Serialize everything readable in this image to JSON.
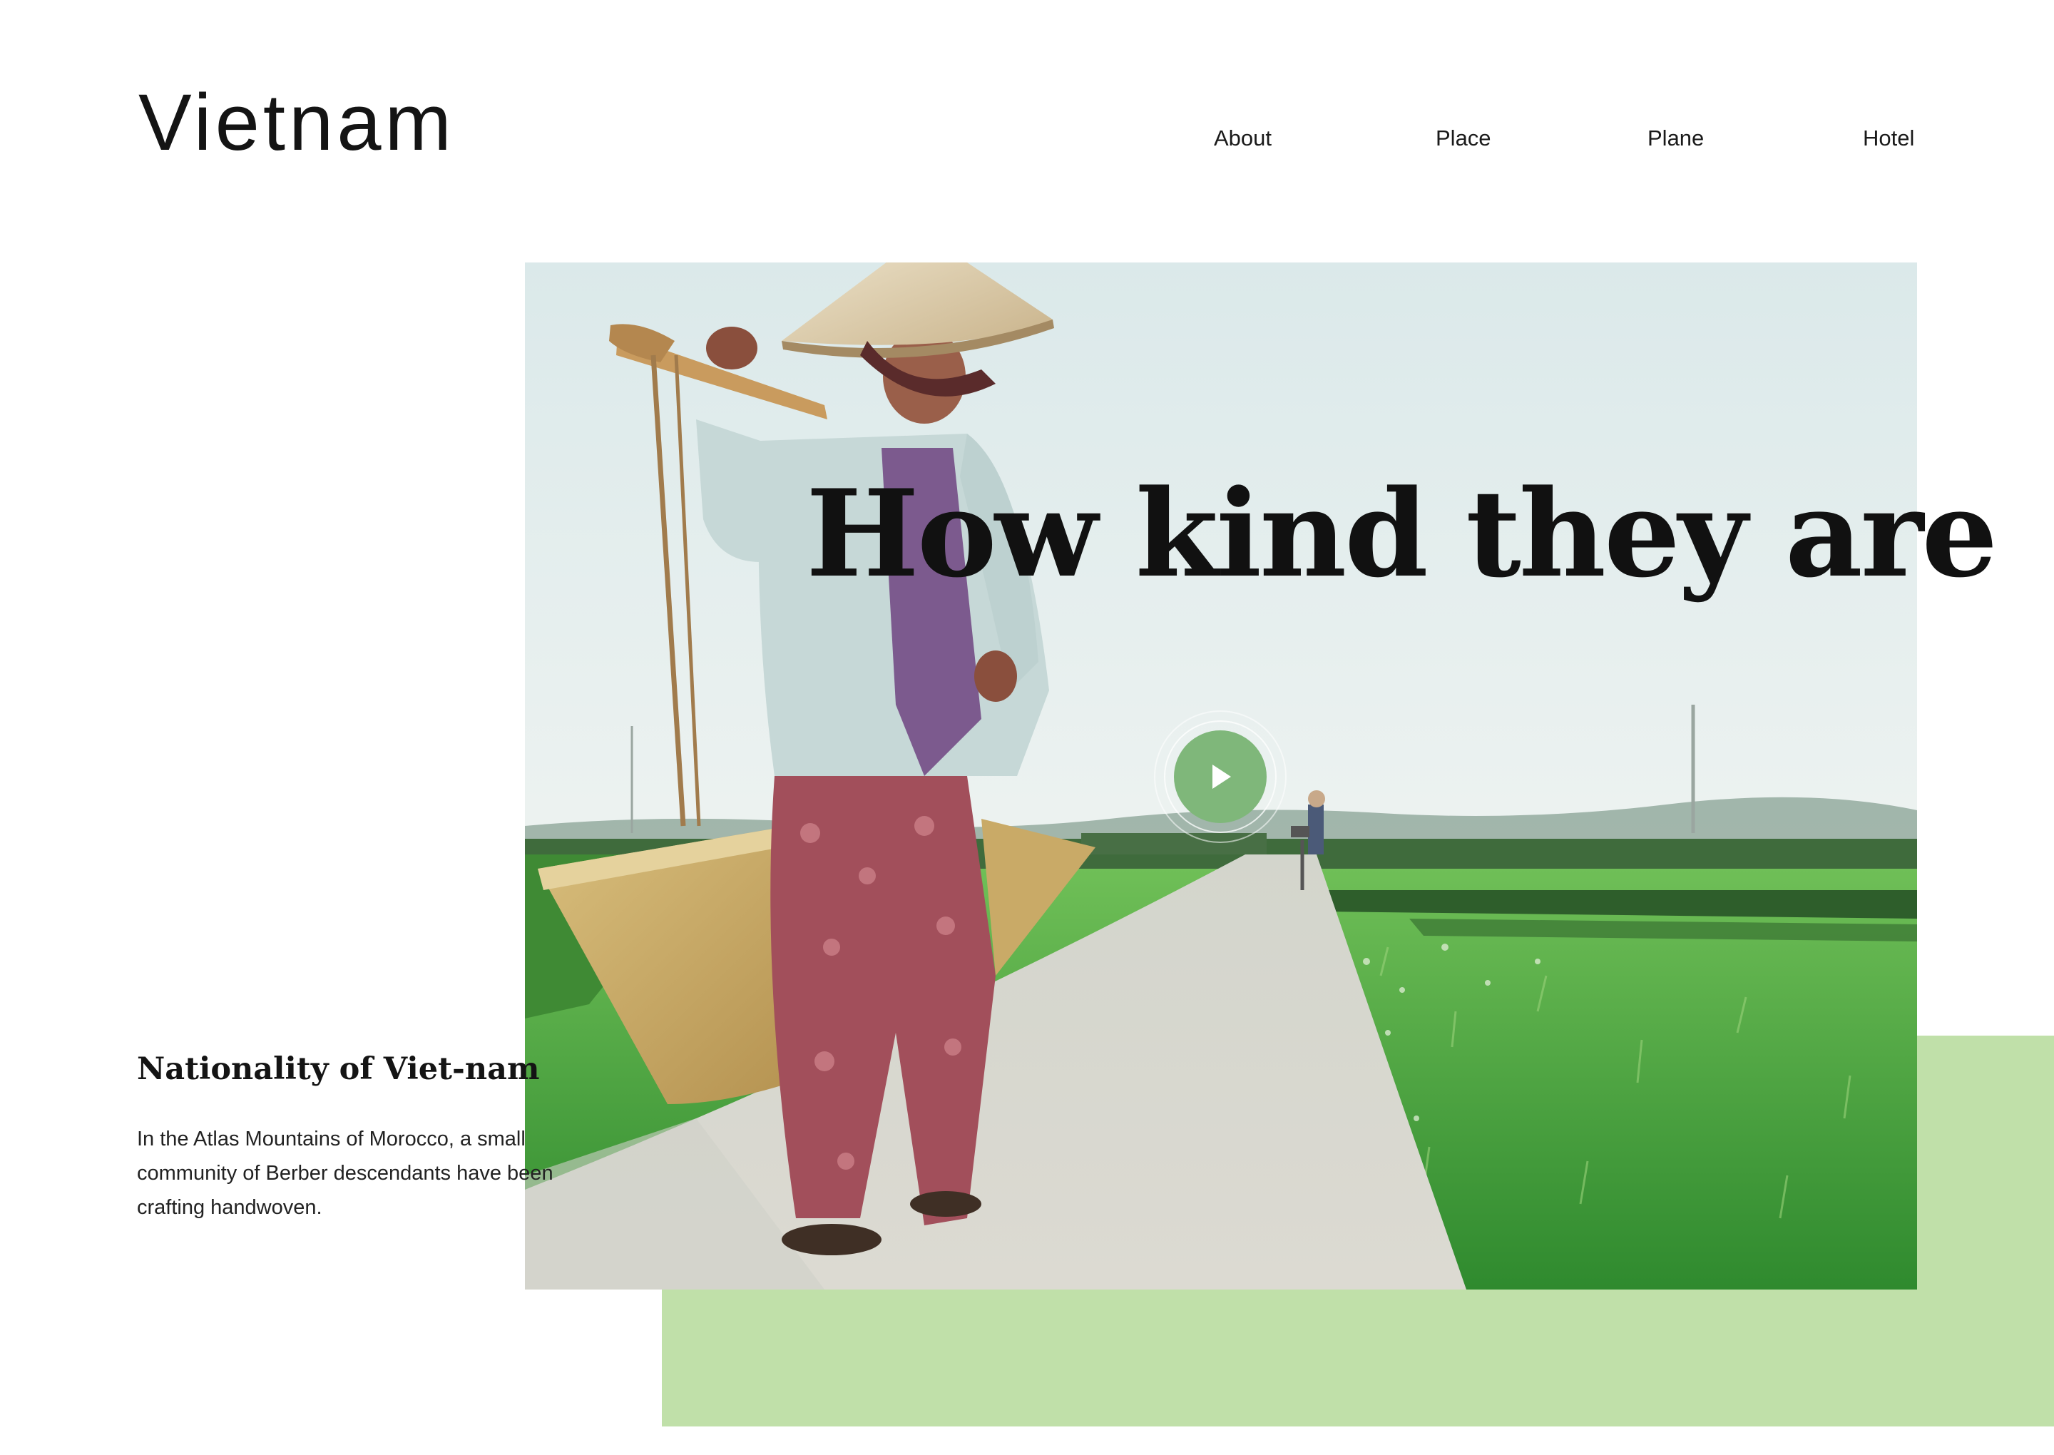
{
  "header": {
    "logo": "Vietnam",
    "nav": [
      {
        "label": "About"
      },
      {
        "label": "Place"
      },
      {
        "label": "Plane"
      },
      {
        "label": "Hotel"
      }
    ]
  },
  "hero": {
    "title": "How kind they are",
    "play_icon": "play-icon",
    "image": "woman-in-conical-hat-carrying-baskets-on-rice-field-path"
  },
  "feature": {
    "title": "Nationality of Viet-nam",
    "body": "In the Atlas Mountains of Morocco, a small community of Berber descendants have been crafting handwoven."
  },
  "colors": {
    "accent_green": "#c0e0a9",
    "play_green": "#7fb77a",
    "text_dark": "#141414",
    "background": "#ffffff"
  }
}
